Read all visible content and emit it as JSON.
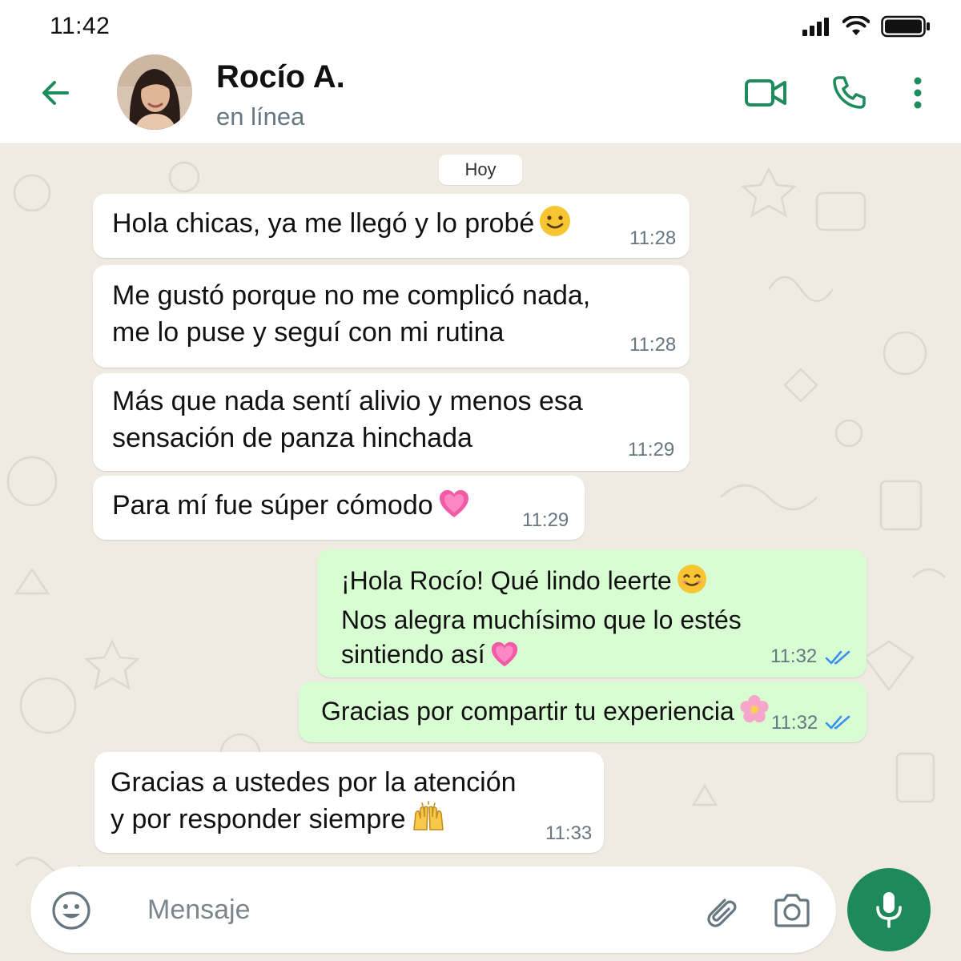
{
  "status_bar": {
    "time": "11:42"
  },
  "header": {
    "contact_name": "Rocío A.",
    "contact_status": "en línea",
    "icons": [
      "back-arrow-icon",
      "video-call-icon",
      "phone-call-icon",
      "more-options-icon"
    ]
  },
  "chat": {
    "day_label": "Hoy",
    "messages": [
      {
        "direction": "in",
        "lines": [
          "Hola chicas, ya me llegó y lo probé"
        ],
        "emoji": "smiling-face-icon",
        "time": "11:28"
      },
      {
        "direction": "in",
        "lines": [
          "Me gustó porque no me complicó nada,",
          "me lo puse y seguí con mi rutina"
        ],
        "time": "11:28"
      },
      {
        "direction": "in",
        "lines": [
          "Más que nada sentí alivio y menos esa",
          "sensación de panza hinchada"
        ],
        "time": "11:29"
      },
      {
        "direction": "in",
        "lines": [
          "Para mí fue súper cómodo"
        ],
        "emoji": "pink-heart-icon",
        "time": "11:29"
      },
      {
        "direction": "out",
        "lines": [
          "¡Hola Rocío! Qué lindo leerte",
          "Nos alegra muchísimo que lo estés",
          "sintiendo así"
        ],
        "emoji": "smiling-face-icon",
        "emoji2": "pink-heart-icon",
        "time": "11:32",
        "read": true
      },
      {
        "direction": "out",
        "lines": [
          "Gracias por compartir tu experiencia"
        ],
        "emoji": "flower-icon",
        "time": "11:32",
        "read": true
      },
      {
        "direction": "in",
        "lines": [
          "Gracias a ustedes por la atención",
          "y por responder siempre"
        ],
        "emoji": "raising-hands-icon",
        "time": "11:33"
      }
    ]
  },
  "composer": {
    "placeholder": "Mensaje",
    "icons": [
      "emoji-icon",
      "attach-icon",
      "camera-icon",
      "mic-icon"
    ]
  },
  "colors": {
    "accent": "#1e8a5c",
    "header_icon": "#1f8c5e",
    "outgoing_bubble": "#d9fdd3",
    "incoming_bubble": "#ffffff",
    "chat_background": "#efeae2",
    "read_ticks": "#3b8ff0"
  }
}
